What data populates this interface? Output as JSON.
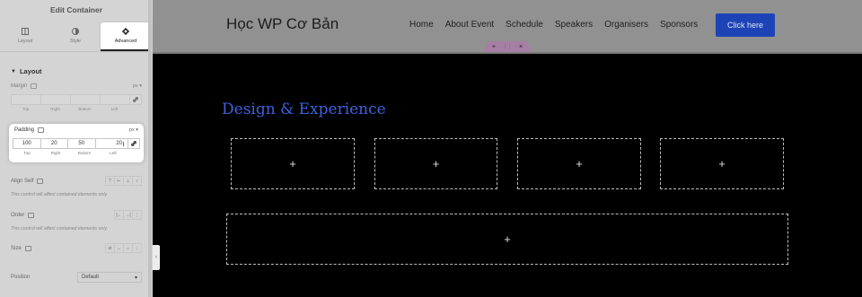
{
  "panel": {
    "title": "Edit Container",
    "tabs": [
      {
        "label": "Layout",
        "icon": "layout-grid-icon",
        "active": false
      },
      {
        "label": "Style",
        "icon": "contrast-icon",
        "active": false
      },
      {
        "label": "Advanced",
        "icon": "gear-icon",
        "active": true
      }
    ],
    "section_title": "Layout",
    "margin": {
      "label": "Margin",
      "unit": "px",
      "values": [
        "",
        "",
        "",
        ""
      ],
      "sides": [
        "Top",
        "Right",
        "Bottom",
        "Left"
      ]
    },
    "padding": {
      "label": "Padding",
      "unit": "px",
      "values": [
        "100",
        "20",
        "50",
        "20"
      ],
      "sides": [
        "Top",
        "Right",
        "Bottom",
        "Left"
      ]
    },
    "align_self": {
      "label": "Align Self",
      "note": "This control will affect contained elements only."
    },
    "order": {
      "label": "Order",
      "note": "This control will affect contained elements only."
    },
    "size": {
      "label": "Size"
    },
    "position": {
      "label": "Position",
      "value": "Default"
    }
  },
  "site": {
    "logo": "Học WP Cơ Bản",
    "nav": [
      "Home",
      "About Event",
      "Schedule",
      "Speakers",
      "Organisers",
      "Sponsors"
    ],
    "cta": "Click here",
    "handle": {
      "add": "+",
      "move": "⋮⋮",
      "close": "×"
    }
  },
  "canvas": {
    "heading": "Design & Experience",
    "add_symbol": "+"
  },
  "colors": {
    "accent": "#3f62dd",
    "cta": "#1d43b7",
    "handle": "#a67fa5"
  }
}
